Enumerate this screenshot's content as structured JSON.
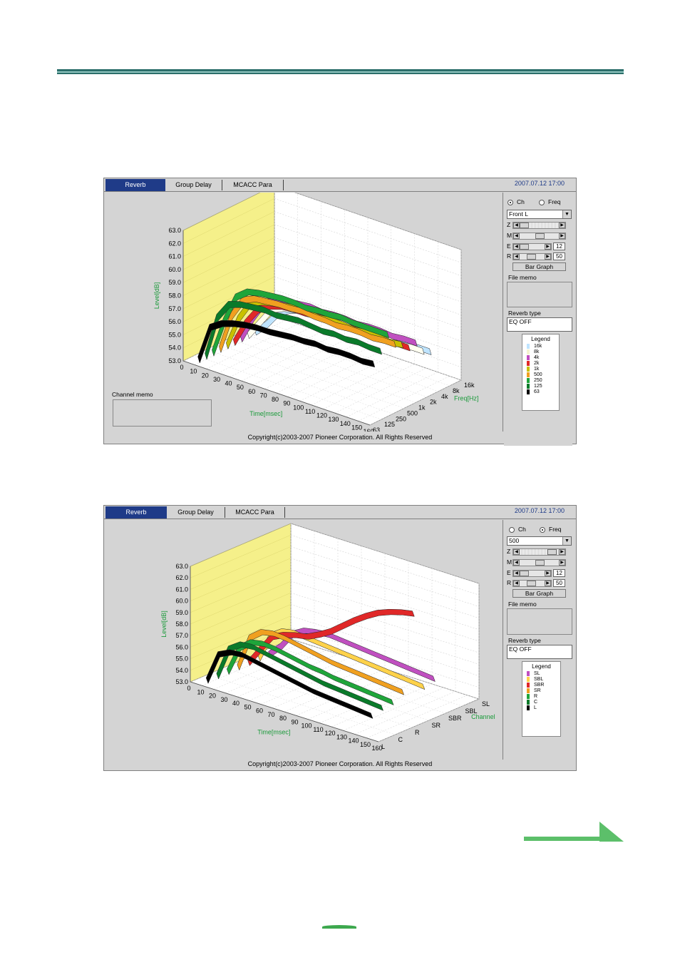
{
  "screens": [
    {
      "tabs": [
        "Reverb",
        "Group Delay",
        "MCACC Para"
      ],
      "active_tab": 0,
      "timestamp": "2007.07.12 17:00",
      "radio_ch": "Ch",
      "radio_freq": "Freq",
      "selected_radio": "Ch",
      "select_value": "Front L",
      "slider_z": "Z",
      "slider_m": "M",
      "slider_e": "E",
      "slider_r": "R",
      "value_e": "12",
      "value_r": "50",
      "bar_graph_label": "Bar Graph",
      "file_memo_label": "File memo",
      "reverb_type_label": "Reverb type",
      "reverb_type_value": "EQ OFF",
      "legend_title": "Legend",
      "legend_items": [
        "16k",
        "8k",
        "4k",
        "2k",
        "1k",
        "500",
        "250",
        "125",
        "63"
      ],
      "channel_memo_label": "Channel memo",
      "copyright": "Copyright(c)2003-2007 Pioneer Corporation. All Rights Reserved",
      "chart_data": {
        "type": "3d-line",
        "ylabel": "Level[dB]",
        "xlabel": "Time[msec]",
        "zlabel": "Freq[Hz]",
        "y_ticks": [
          "63.0",
          "62.0",
          "61.0",
          "60.0",
          "59.0",
          "58.0",
          "57.0",
          "56.0",
          "55.0",
          "54.0",
          "53.0"
        ],
        "x_ticks": [
          "0",
          "10",
          "20",
          "30",
          "40",
          "50",
          "60",
          "70",
          "80",
          "90",
          "100",
          "110",
          "120",
          "130",
          "140",
          "150",
          "160"
        ],
        "z_ticks": [
          "63",
          "125",
          "250",
          "500",
          "1k",
          "2k",
          "4k",
          "8k",
          "16k"
        ],
        "ylim": [
          53,
          63
        ],
        "xlim": [
          0,
          160
        ],
        "series": [
          {
            "name": "63",
            "color": "#000000",
            "values": [
              53.0,
              55.8,
              56.4,
              56.7,
              56.9,
              57.0,
              57.0,
              57.1,
              57.2,
              57.2,
              57.3,
              57.2,
              57.3,
              57.3,
              57.2,
              57.3
            ]
          },
          {
            "name": "125",
            "color": "#0a7a2a",
            "values": [
              53.0,
              56.3,
              57.6,
              57.9,
              58.0,
              58.1,
              58.0,
              58.1,
              58.2,
              58.1,
              58.0,
              58.1,
              58.0,
              58.1,
              58.0,
              58.0
            ]
          },
          {
            "name": "250",
            "color": "#1fa53a",
            "values": [
              53.0,
              55.8,
              57.9,
              58.6,
              58.8,
              58.9,
              59.0,
              59.0,
              58.9,
              59.0,
              59.0,
              59.1,
              59.0,
              59.0,
              59.0,
              59.0
            ]
          },
          {
            "name": "500",
            "color": "#f0a020",
            "values": [
              53.0,
              55.9,
              57.4,
              57.8,
              57.9,
              58.0,
              58.0,
              58.1,
              58.0,
              58.0,
              57.9,
              58.0,
              58.0,
              57.9,
              58.0,
              58.0
            ]
          },
          {
            "name": "1k",
            "color": "#c8c000",
            "values": [
              53.0,
              55.4,
              56.9,
              57.3,
              57.5,
              57.6,
              57.7,
              57.7,
              57.6,
              57.7,
              57.7,
              57.6,
              57.7,
              57.7,
              57.6,
              57.7
            ]
          },
          {
            "name": "2k",
            "color": "#e02828",
            "values": [
              53.0,
              54.8,
              56.1,
              56.7,
              57.0,
              57.1,
              57.1,
              57.2,
              57.2,
              57.1,
              57.2,
              57.2,
              57.2,
              57.1,
              57.2,
              57.2
            ]
          },
          {
            "name": "4k",
            "color": "#c050c0",
            "values": [
              53.0,
              54.9,
              56.4,
              56.9,
              57.1,
              57.2,
              57.3,
              57.2,
              57.3,
              57.3,
              57.2,
              57.3,
              57.3,
              57.2,
              57.3,
              57.3
            ]
          },
          {
            "name": "8k",
            "color": "#fffff0",
            "values": [
              53.0,
              54.3,
              55.6,
              56.0,
              56.2,
              56.3,
              56.4,
              56.3,
              56.4,
              56.4,
              56.3,
              56.4,
              56.4,
              56.3,
              56.4,
              56.4
            ]
          },
          {
            "name": "16k",
            "color": "#bfe4ff",
            "values": [
              53.0,
              53.9,
              55.1,
              55.6,
              55.9,
              56.0,
              56.1,
              56.0,
              56.1,
              56.1,
              56.0,
              56.1,
              56.1,
              56.0,
              56.1,
              56.1
            ]
          }
        ]
      }
    },
    {
      "tabs": [
        "Reverb",
        "Group Delay",
        "MCACC Para"
      ],
      "active_tab": 0,
      "timestamp": "2007.07.12 17:00",
      "radio_ch": "Ch",
      "radio_freq": "Freq",
      "selected_radio": "Freq",
      "select_value": "500",
      "slider_z": "Z",
      "slider_m": "M",
      "slider_e": "E",
      "slider_r": "R",
      "value_e": "12",
      "value_r": "50",
      "bar_graph_label": "Bar Graph",
      "file_memo_label": "File memo",
      "reverb_type_label": "Reverb type",
      "reverb_type_value": "EQ OFF",
      "legend_title": "Legend",
      "legend_items": [
        "SL",
        "SBL",
        "SBR",
        "SR",
        "R",
        "C",
        "L"
      ],
      "copyright": "Copyright(c)2003-2007 Pioneer Corporation. All Rights Reserved",
      "chart_data": {
        "type": "3d-line",
        "ylabel": "Level[dB]",
        "xlabel": "Time[msec]",
        "zlabel": "Channel",
        "y_ticks": [
          "63.0",
          "62.0",
          "61.0",
          "60.0",
          "59.0",
          "58.0",
          "57.0",
          "56.0",
          "55.0",
          "54.0",
          "53.0"
        ],
        "x_ticks": [
          "0",
          "10",
          "20",
          "30",
          "40",
          "50",
          "60",
          "70",
          "80",
          "90",
          "100",
          "110",
          "120",
          "130",
          "140",
          "150",
          "160"
        ],
        "z_ticks": [
          "L",
          "C",
          "R",
          "SR",
          "SBR",
          "SBL",
          "SL"
        ],
        "ylim": [
          53,
          63
        ],
        "xlim": [
          0,
          160
        ],
        "series": [
          {
            "name": "L",
            "color": "#000000",
            "values": [
              53.0,
              55.6,
              56.1,
              56.2,
              56.0,
              55.8,
              55.6,
              55.4,
              55.2,
              55.0,
              54.9,
              54.8,
              54.7,
              54.6,
              54.5
            ]
          },
          {
            "name": "C",
            "color": "#0a7a2a",
            "values": [
              53.0,
              55.7,
              56.4,
              56.5,
              56.3,
              56.1,
              55.9,
              55.7,
              55.5,
              55.3,
              55.2,
              55.1,
              55.0,
              54.9,
              54.8
            ]
          },
          {
            "name": "R",
            "color": "#1fa53a",
            "values": [
              53.0,
              55.4,
              56.2,
              56.4,
              56.3,
              56.1,
              55.9,
              55.7,
              55.6,
              55.4,
              55.3,
              55.2,
              55.1,
              55.0,
              54.9
            ]
          },
          {
            "name": "SR",
            "color": "#f0a020",
            "values": [
              53.0,
              55.9,
              56.7,
              56.9,
              56.8,
              56.6,
              56.4,
              56.2,
              56.0,
              55.9,
              55.8,
              55.7,
              55.6,
              55.5,
              55.4
            ]
          },
          {
            "name": "SBR",
            "color": "#e02828",
            "values": [
              53.0,
              54.5,
              55.9,
              56.4,
              56.7,
              56.9,
              57.4,
              58.0,
              58.8,
              59.6,
              60.3,
              60.9,
              61.3,
              61.6,
              61.8
            ]
          },
          {
            "name": "SBL",
            "color": "#ffd24a",
            "values": [
              53.0,
              55.3,
              56.0,
              56.2,
              56.1,
              56.0,
              55.9,
              55.8,
              55.7,
              55.6,
              55.5,
              55.4,
              55.3,
              55.2,
              55.1
            ]
          },
          {
            "name": "SL",
            "color": "#c050c0",
            "values": [
              53.0,
              54.0,
              55.4,
              56.0,
              56.2,
              56.3,
              56.2,
              56.1,
              56.0,
              55.9,
              55.8,
              55.7,
              55.6,
              55.5,
              55.4
            ]
          }
        ]
      }
    }
  ],
  "colors": {
    "header_rule": "#2b6e6a",
    "header_rule_light": "#8fc4bf",
    "nav_arrow": "#5cbf6a",
    "tab_active": "#1f3b88",
    "wall_yellow": "#f5f08a"
  },
  "icons": {
    "next_page": "arrow-right-icon",
    "dropdown": "chevron-down-icon"
  }
}
